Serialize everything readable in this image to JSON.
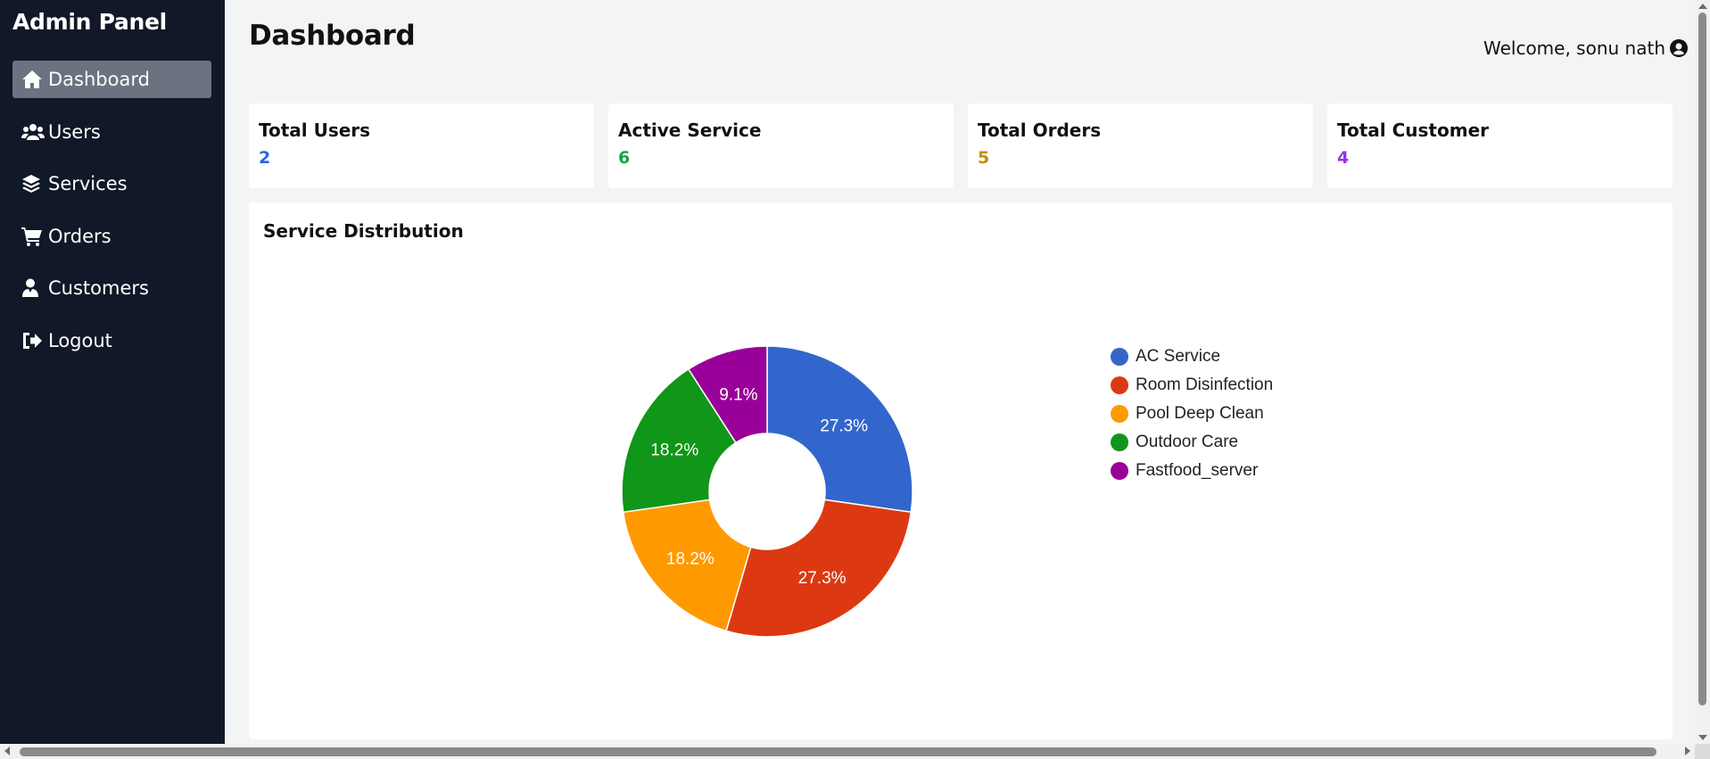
{
  "sidebar": {
    "brand": "Admin Panel",
    "items": [
      {
        "label": "Dashboard",
        "icon": "home-icon",
        "active": true
      },
      {
        "label": "Users",
        "icon": "users-icon",
        "active": false
      },
      {
        "label": "Services",
        "icon": "layers-icon",
        "active": false
      },
      {
        "label": "Orders",
        "icon": "cart-icon",
        "active": false
      },
      {
        "label": "Customers",
        "icon": "user-tie-icon",
        "active": false
      },
      {
        "label": "Logout",
        "icon": "logout-icon",
        "active": false
      }
    ]
  },
  "header": {
    "title": "Dashboard",
    "welcome": "Welcome, sonu nath",
    "welcome_icon": "user-circle-icon"
  },
  "stats": [
    {
      "label": "Total Users",
      "value": "2",
      "color": "#2563eb"
    },
    {
      "label": "Active Service",
      "value": "6",
      "color": "#16a34a"
    },
    {
      "label": "Total Orders",
      "value": "5",
      "color": "#ca8a04"
    },
    {
      "label": "Total Customer",
      "value": "4",
      "color": "#9333ea"
    }
  ],
  "chart": {
    "title": "Service Distribution"
  },
  "chart_data": {
    "type": "pie",
    "donut": true,
    "title": "Service Distribution",
    "legend_position": "right",
    "categories": [
      "AC Service",
      "Room Disinfection",
      "Pool Deep Clean",
      "Outdoor Care",
      "Fastfood_server"
    ],
    "values": [
      27.3,
      27.3,
      18.2,
      18.2,
      9.1
    ],
    "labels": [
      "27.3%",
      "27.3%",
      "18.2%",
      "18.2%",
      "9.1%"
    ],
    "colors": [
      "#3366cc",
      "#dc3912",
      "#ff9900",
      "#109618",
      "#990099"
    ]
  }
}
